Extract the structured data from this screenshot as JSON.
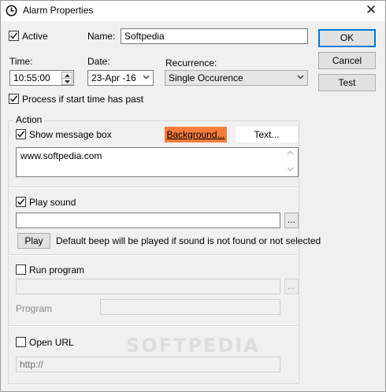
{
  "window": {
    "title": "Alarm Properties",
    "close_glyph": "✕"
  },
  "general": {
    "active_label": "Active",
    "active_checked": true,
    "name_label": "Name:",
    "name_value": "Softpedia",
    "time_label": "Time:",
    "time_value": "10:55:00",
    "date_label": "Date:",
    "date_value": "23-Apr -16",
    "recurrence_label": "Recurrence:",
    "recurrence_value": "Single Occurence",
    "process_label": "Process if start time has past",
    "process_checked": true
  },
  "buttons": {
    "ok": "OK",
    "cancel": "Cancel",
    "test": "Test"
  },
  "action": {
    "group_label": "Action",
    "show_message_label": "Show message box",
    "show_message_checked": true,
    "background_button": "Background...",
    "text_button": "Text...",
    "message_text": "www.softpedia.com",
    "play_sound_label": "Play sound",
    "play_sound_checked": true,
    "sound_path": "",
    "browse_button": "...",
    "play_button": "Play",
    "sound_note": "Default beep will be played if sound is not found or not selected",
    "run_program_label": "Run program",
    "run_program_checked": false,
    "program_path": "",
    "program_browse": "...",
    "program_label": "Program",
    "program_args": "",
    "open_url_label": "Open URL",
    "open_url_checked": false,
    "url_value": "http://"
  },
  "watermark": "SOFTPEDIA",
  "colors": {
    "accent": "#0078d7",
    "background_button": "#f57c3b"
  }
}
